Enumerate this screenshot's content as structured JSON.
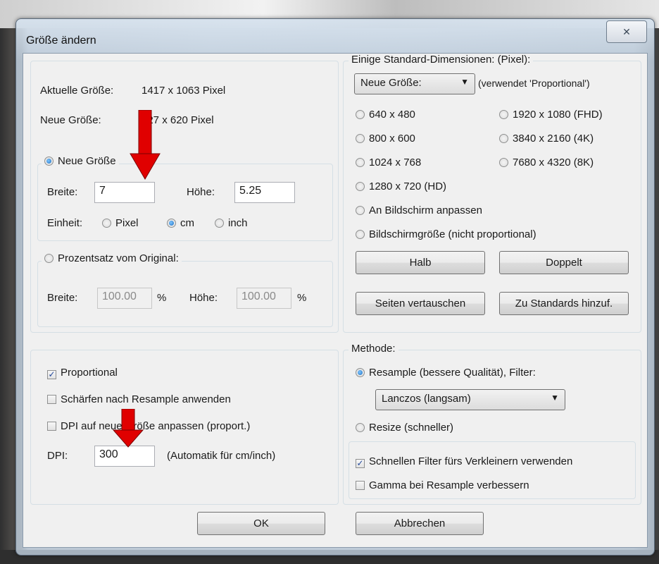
{
  "window": {
    "title": "Größe ändern",
    "close_icon": "✕"
  },
  "current_size": {
    "label": "Aktuelle Größe:",
    "value": "1417 x 1063 Pixel"
  },
  "new_size": {
    "label": "Neue Größe:",
    "value": "827 x 620 Pixel"
  },
  "mode_new": {
    "label": "Neue Größe",
    "width_label": "Breite:",
    "width_value": "7",
    "height_label": "Höhe:",
    "height_value": "5.25",
    "unit_label": "Einheit:",
    "units": [
      "Pixel",
      "cm",
      "inch"
    ],
    "selected_unit": "cm"
  },
  "mode_percent": {
    "label": "Prozentsatz vom Original:",
    "width_label": "Breite:",
    "width_value": "100.00",
    "pct1": "%",
    "height_label": "Höhe:",
    "height_value": "100.00",
    "pct2": "%"
  },
  "options": {
    "proportional": "Proportional",
    "sharpen": "Schärfen nach Resample anwenden",
    "dpi_adjust": "DPI auf neue Größe anpassen (proport.)",
    "dpi_label": "DPI:",
    "dpi_value": "300",
    "dpi_note": "(Automatik für cm/inch)"
  },
  "standard": {
    "title": "Einige Standard-Dimensionen: (Pixel):",
    "dropdown": "Neue Größe:",
    "dropdown_note": "(verwendet 'Proportional')",
    "opt_640": "640 x 480",
    "opt_800": "800 x 600",
    "opt_1024": "1024 x 768",
    "opt_1280": "1280 x 720  (HD)",
    "opt_1920": "1920 x 1080 (FHD)",
    "opt_3840": "3840 x 2160 (4K)",
    "opt_7680": "7680 x 4320 (8K)",
    "fit_screen": "An Bildschirm anpassen",
    "screen_size": "Bildschirmgröße (nicht proportional)",
    "half": "Halb",
    "double": "Doppelt",
    "swap": "Seiten vertauschen",
    "add_standard": "Zu Standards hinzuf."
  },
  "method": {
    "title": "Methode:",
    "resample": "Resample (bessere Qualität), Filter:",
    "filter": "Lanczos (langsam)",
    "resize": "Resize (schneller)",
    "fast_filter": "Schnellen Filter fürs Verkleinern verwenden",
    "gamma": "Gamma bei Resample verbessern"
  },
  "buttons": {
    "ok": "OK",
    "cancel": "Abbrechen"
  },
  "colors": {
    "annotation_arrow": "#e00000"
  }
}
